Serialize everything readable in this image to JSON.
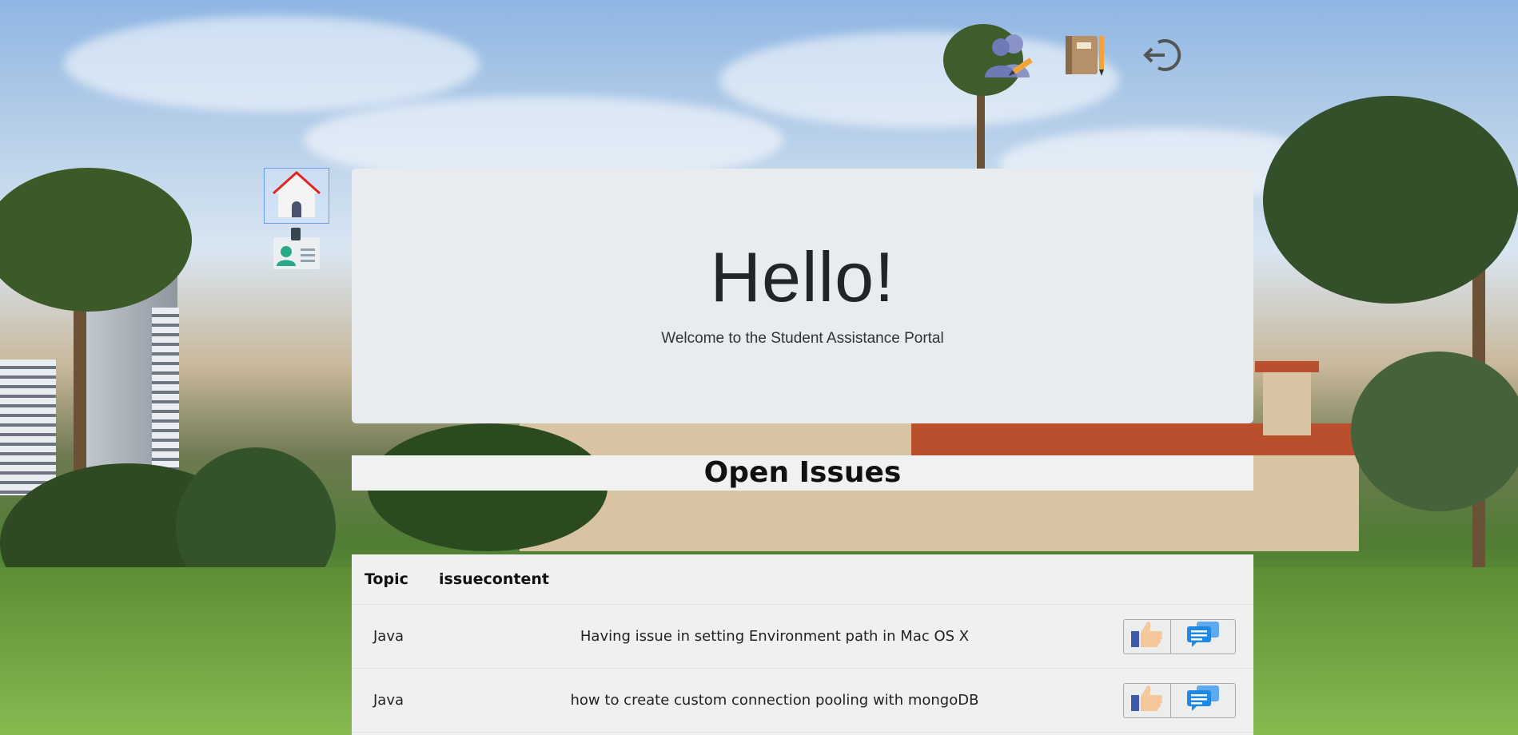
{
  "nav": {
    "top_icons": [
      "user-edit-icon",
      "notebook-pencil-icon",
      "logout-icon"
    ],
    "side_items": [
      "home-icon",
      "id-badge-icon"
    ]
  },
  "hero": {
    "title": "Hello!",
    "subtitle": "Welcome to the Student Assistance Portal"
  },
  "issues": {
    "heading": "Open Issues",
    "columns": [
      "Topic",
      "issuecontent"
    ],
    "rows": [
      {
        "topic": "Java",
        "content": "Having issue in setting Environment path in Mac OS X"
      },
      {
        "topic": "Java",
        "content": "how to create custom connection pooling with mongoDB"
      }
    ],
    "row_action_icons": [
      "thumbs-up-icon",
      "chat-icon"
    ]
  },
  "colors": {
    "hero_bg": "#e9ecef",
    "active_border": "#6c9cf0",
    "chat_blue": "#1e88e5"
  }
}
